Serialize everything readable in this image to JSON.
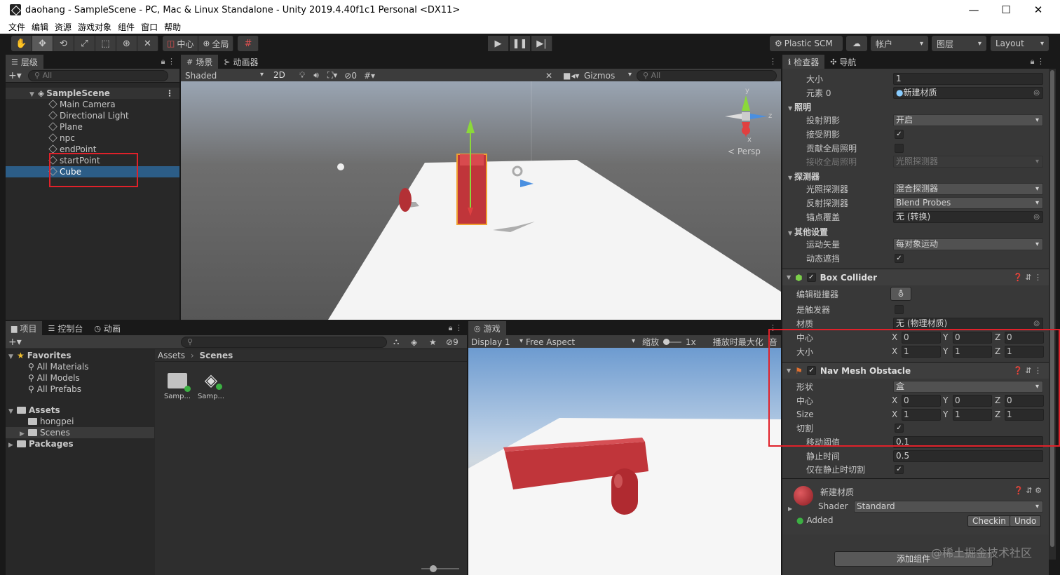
{
  "window": {
    "title": "daohang - SampleScene - PC, Mac & Linux Standalone - Unity 2019.4.40f1c1 Personal <DX11>",
    "minimize": "—",
    "maximize": "☐",
    "close": "✕"
  },
  "menu": [
    "文件",
    "编辑",
    "资源",
    "游戏对象",
    "组件",
    "窗口",
    "帮助"
  ],
  "toolbar": {
    "pivot": "中心",
    "global": "全局",
    "plastic": "Plastic SCM",
    "account": "帐户",
    "layers": "图层",
    "layout": "Layout"
  },
  "hierarchy": {
    "tab": "层级",
    "search": "All",
    "scene": "SampleScene",
    "items": [
      "Main Camera",
      "Directional Light",
      "Plane",
      "npc",
      "endPoint",
      "startPoint",
      "Cube"
    ],
    "selected": "Cube"
  },
  "scene": {
    "tab_scene": "场景",
    "tab_animator": "动画器",
    "shading": "Shaded",
    "mode2d": "2D",
    "hidden_count": "0",
    "gizmos": "Gizmos",
    "search": "All",
    "persp": "Persp",
    "axis_y": "y",
    "axis_x": "x",
    "axis_z": "z"
  },
  "project": {
    "tab_project": "项目",
    "tab_console": "控制台",
    "tab_animation": "动画",
    "hidden_count": "9",
    "favorites": "Favorites",
    "fav_items": [
      "All Materials",
      "All Models",
      "All Prefabs"
    ],
    "assets": "Assets",
    "asset_items": [
      "hongpei",
      "Scenes"
    ],
    "packages": "Packages",
    "breadcrumb_root": "Assets",
    "breadcrumb_leaf": "Scenes",
    "files": [
      "Samp...",
      "Samp..."
    ]
  },
  "game": {
    "tab": "游戏",
    "display": "Display 1",
    "aspect": "Free Aspect",
    "scale_label": "缩放",
    "scale_value": "1x",
    "maximize": "播放时最大化",
    "audio": "音"
  },
  "inspector": {
    "tab_inspector": "检查器",
    "tab_nav": "导航",
    "size_label": "大小",
    "size_value": "1",
    "element0_label": "元素 0",
    "element0_value": "新建材质",
    "lighting": "照明",
    "cast_shadows_label": "投射阴影",
    "cast_shadows_value": "开启",
    "receive_shadows_label": "接受阴影",
    "contribute_gi_label": "贡献全局照明",
    "receive_gi_label": "接收全局照明",
    "receive_gi_value": "光照探测器",
    "probes": "探测器",
    "light_probes_label": "光照探测器",
    "light_probes_value": "混合探测器",
    "reflection_probes_label": "反射探测器",
    "reflection_probes_value": "Blend Probes",
    "anchor_label": "锚点覆盖",
    "anchor_value": "无 (转换)",
    "other": "其他设置",
    "motion_label": "运动矢量",
    "motion_value": "每对象运动",
    "dynamic_occ_label": "动态遮挡",
    "box_collider": "Box Collider",
    "edit_collider_label": "编辑碰撞器",
    "is_trigger_label": "是触发器",
    "material_label": "材质",
    "material_value": "无 (物理材质)",
    "center_label": "中心",
    "center": [
      "0",
      "0",
      "0"
    ],
    "bsize_label": "大小",
    "bsize": [
      "1",
      "1",
      "1"
    ],
    "nav_obstacle": "Nav Mesh Obstacle",
    "shape_label": "形状",
    "shape_value": "盒",
    "ncenter_label": "中心",
    "ncenter": [
      "0",
      "0",
      "0"
    ],
    "nsize_label": "Size",
    "nsize": [
      "1",
      "1",
      "1"
    ],
    "carve_label": "切割",
    "move_threshold_label": "移动阈值",
    "move_threshold_value": "0.1",
    "stationary_label": "静止时间",
    "stationary_value": "0.5",
    "carve_stationary_label": "仅在静止时切割",
    "material_name": "新建材质",
    "shader_label": "Shader",
    "shader_value": "Standard",
    "added": "Added",
    "checkin": "Checkin",
    "undo": "Undo",
    "add_component": "添加组件",
    "watermark": "@稀土掘金技术社区"
  },
  "colors": {
    "selection": "#2c5d87",
    "annotation": "#e0212a",
    "cube": "#c0353a",
    "sky": "#8db3da"
  }
}
